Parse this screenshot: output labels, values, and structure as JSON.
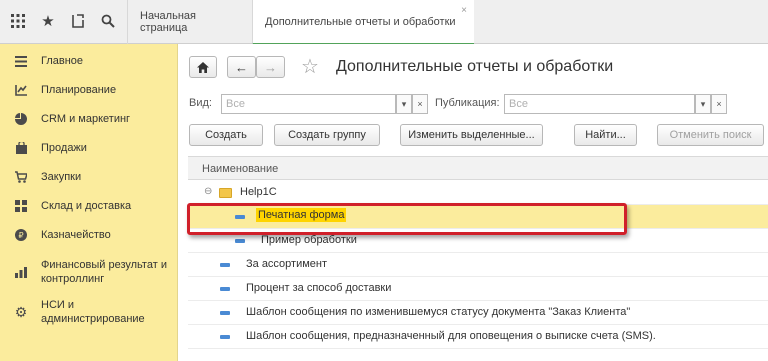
{
  "topbar": {
    "icons": [
      "grid-icon",
      "star-icon",
      "history-icon",
      "search-icon"
    ],
    "tabs": [
      {
        "label": "Начальная страница",
        "active": false
      },
      {
        "label": "Дополнительные отчеты и обработки",
        "active": true,
        "close": "×"
      }
    ]
  },
  "sidebar": {
    "items": [
      {
        "label": "Главное",
        "icon": "menu-lines-icon"
      },
      {
        "label": "Планирование",
        "icon": "planning-icon"
      },
      {
        "label": "CRM и маркетинг",
        "icon": "pie-chart-icon"
      },
      {
        "label": "Продажи",
        "icon": "bag-icon"
      },
      {
        "label": "Закупки",
        "icon": "cart-icon"
      },
      {
        "label": "Склад и доставка",
        "icon": "warehouse-grid-icon"
      },
      {
        "label": "Казначейство",
        "icon": "coin-icon"
      },
      {
        "label": "Финансовый результат и контроллинг",
        "icon": "bar-chart-icon"
      },
      {
        "label": "НСИ и администрирование",
        "icon": "gear-icon"
      }
    ],
    "bg_color": "#fbec9d"
  },
  "main": {
    "title": "Дополнительные отчеты и обработки",
    "filters": {
      "kind_label": "Вид:",
      "kind_value": "Все",
      "publication_label": "Публикация:",
      "publication_value": "Все",
      "dropdown_glyph": "▾",
      "clear_glyph": "×"
    },
    "buttons": {
      "create": "Создать",
      "create_group": "Создать группу",
      "edit_selected": "Изменить выделенные...",
      "find": "Найти...",
      "cancel_search": "Отменить поиск"
    },
    "list": {
      "column_header": "Наименование",
      "group": {
        "label": "Help1C",
        "toggle": "⊖"
      },
      "rows": [
        {
          "label": "Печатная форма",
          "selected": true
        },
        {
          "label": "Пример обработки",
          "selected": false
        },
        {
          "label": "За ассортимент",
          "selected": false
        },
        {
          "label": "Процент за способ доставки",
          "selected": false
        },
        {
          "label": "Шаблон сообщения по изменившемуся статусу документа \"Заказ Клиента\"",
          "selected": false
        },
        {
          "label": "Шаблон сообщения, предназначенный для оповещения о выписке счета (SMS).",
          "selected": false
        }
      ]
    },
    "colors": {
      "selection": "#fbec9d",
      "highlight": "#ffd400",
      "callout": "#d0202a",
      "active_tab": "#52a35a"
    }
  }
}
